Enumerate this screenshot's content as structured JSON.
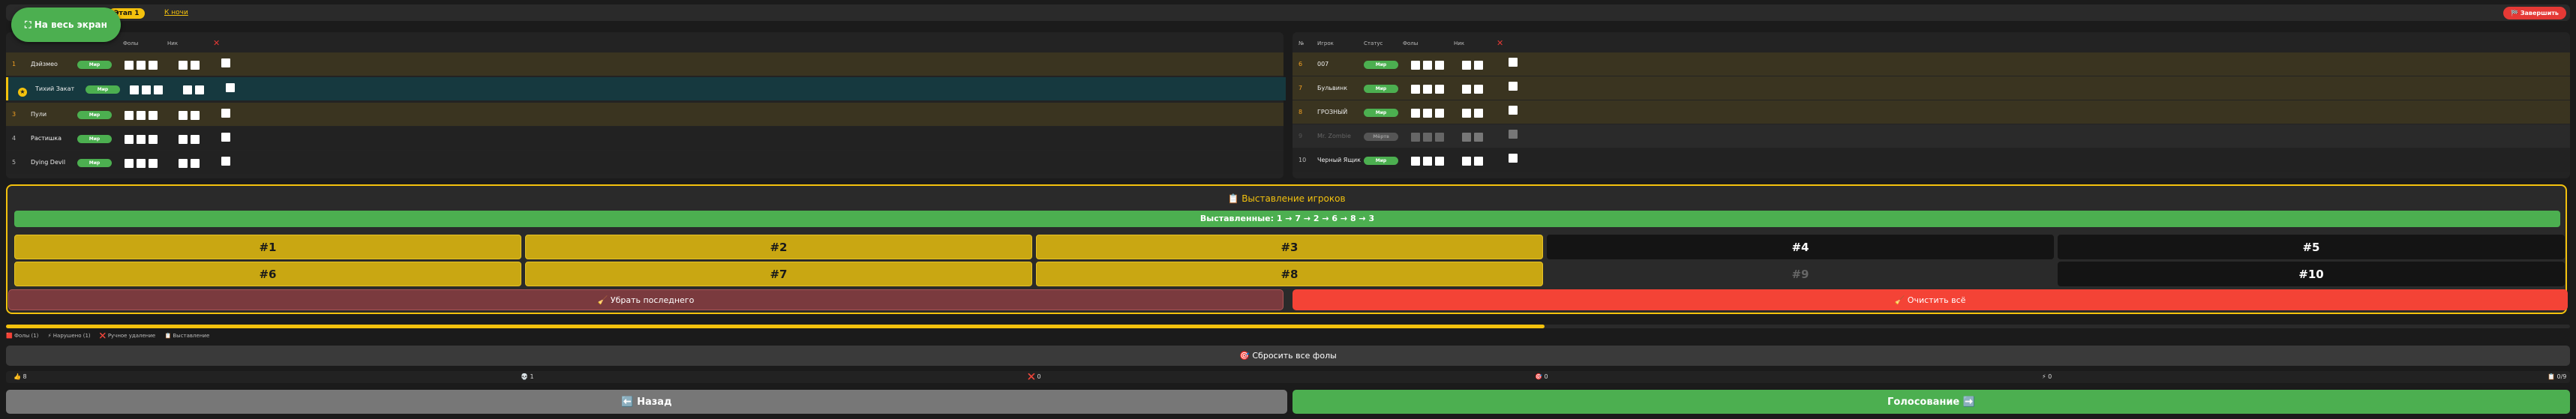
{
  "header": {
    "fullscreen_label": "⛶ На весь экран",
    "stage_badge": "Этап 1",
    "to_night": "К ночи",
    "finish_label": "🏁 Завершить"
  },
  "table_headers": {
    "left": {
      "fouls": "Фолы",
      "votes": "Ник"
    },
    "right": {
      "num": "№",
      "player": "Игрок",
      "status": "Статус",
      "fouls": "Фолы",
      "votes": "Ник"
    },
    "x_mark": "✕"
  },
  "left_players": [
    {
      "num": "1",
      "name": "Дэйзмео",
      "role": "Мир"
    },
    {
      "num": "2",
      "name": "Тихий Закат",
      "role": "Мир"
    },
    {
      "num": "3",
      "name": "Пули",
      "role": "Мир"
    },
    {
      "num": "4",
      "name": "Растишка",
      "role": "Мир"
    },
    {
      "num": "5",
      "name": "Dying Devil",
      "role": "Мир"
    }
  ],
  "right_players": [
    {
      "num": "6",
      "name": "007",
      "role": "Мир"
    },
    {
      "num": "7",
      "name": "Бульвинк",
      "role": "Мир"
    },
    {
      "num": "8",
      "name": "ГРОЗНЫЙ",
      "role": "Мир"
    },
    {
      "num": "9",
      "name": "Mr. Zombie",
      "role": "Мёртв"
    },
    {
      "num": "10",
      "name": "Черный Ящик",
      "role": "Мир"
    }
  ],
  "nominations": {
    "title": "📋 Выставление игроков",
    "list": "Выставленные: 1 → 7 → 2 → 6 → 8 → 3",
    "buttons": [
      "#1",
      "#2",
      "#3",
      "#4",
      "#5",
      "#6",
      "#7",
      "#8",
      "#9",
      "#10"
    ],
    "remove_last": "🧹 Убрать последнего",
    "clear_all": "🧹 Очистить всё"
  },
  "progress": {
    "value": 0.6
  },
  "legend": [
    "🟥 Фолы (1)",
    "⚡ Нарушено (1)",
    "❌ Ручное удаление",
    "📋 Выставление"
  ],
  "reset_fouls": "🎯 Сбросить все фолы",
  "stats": [
    "👍 8",
    "💀 1",
    "❌ 0",
    "🎯 0",
    "⚡ 0",
    "📋 0/9"
  ],
  "footer": {
    "back": "⬅️ Назад",
    "vote": "Голосование ➡️"
  },
  "colors": {
    "accent": "#f4c20d",
    "green": "#4caf50",
    "red": "#f44336"
  }
}
